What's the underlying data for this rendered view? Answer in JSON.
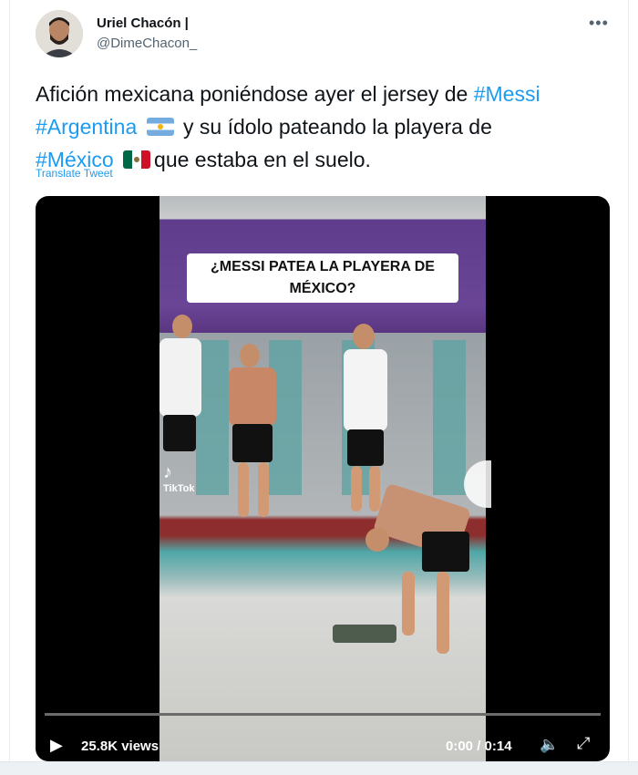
{
  "tweet": {
    "author_name": "Uriel Chacón |",
    "author_handle": "@DimeChacon_",
    "more_icon": "more-horizontal-icon",
    "text_segments": {
      "line1_plain": "Afición mexicana poniéndose ayer el jersey de ",
      "hashtag_messi": "#Messi",
      "hashtag_argentina": "#Argentina",
      "line2_after_flag": " y su ídolo pateando la playera de",
      "hashtag_mexico": "#México",
      "line3_after_flag": "que estaba en el suelo."
    },
    "translate_label": "Translate Tweet"
  },
  "video": {
    "overlay_caption": "¿MESSI PATEA LA PLAYERA DE MÉXICO?",
    "watermark_app": "TikTok",
    "views_label": "25.8K views",
    "time_label": "0:00 / 0:14",
    "progress_fraction": 0.0
  },
  "colors": {
    "accent": "#1d9bf0",
    "text": "#0f1419",
    "secondary": "#536471"
  }
}
